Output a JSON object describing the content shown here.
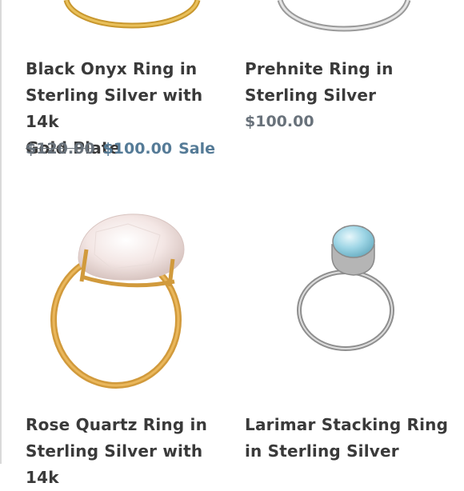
{
  "products": [
    {
      "title": "Black Onyx Ring in Sterling Silver with 14k Gold Plate",
      "title_lines": [
        "Black Onyx Ring in",
        "Sterling Silver with 14k",
        "Gold Plate"
      ],
      "compare_price": "$120.00",
      "price": "$100.00",
      "badge": "Sale",
      "image": "gold-ring-image"
    },
    {
      "title": "Prehnite Ring in Sterling Silver",
      "title_lines": [
        "Prehnite Ring in",
        "Sterling Silver"
      ],
      "price": "$100.00",
      "image": "silver-ring-image"
    },
    {
      "title": "Rose Quartz Ring in Sterling Silver with 14k",
      "title_lines": [
        "Rose Quartz Ring in",
        "Sterling Silver with 14k"
      ],
      "image": "rose-quartz-ring-image"
    },
    {
      "title": "Larimar Stacking Ring in Sterling Silver",
      "title_lines": [
        "Larimar Stacking Ring",
        "in Sterling Silver"
      ],
      "image": "larimar-ring-image"
    }
  ],
  "colors": {
    "title": "#3a3a3a",
    "sale_price": "#557b97",
    "regular_price": "#69727b"
  }
}
